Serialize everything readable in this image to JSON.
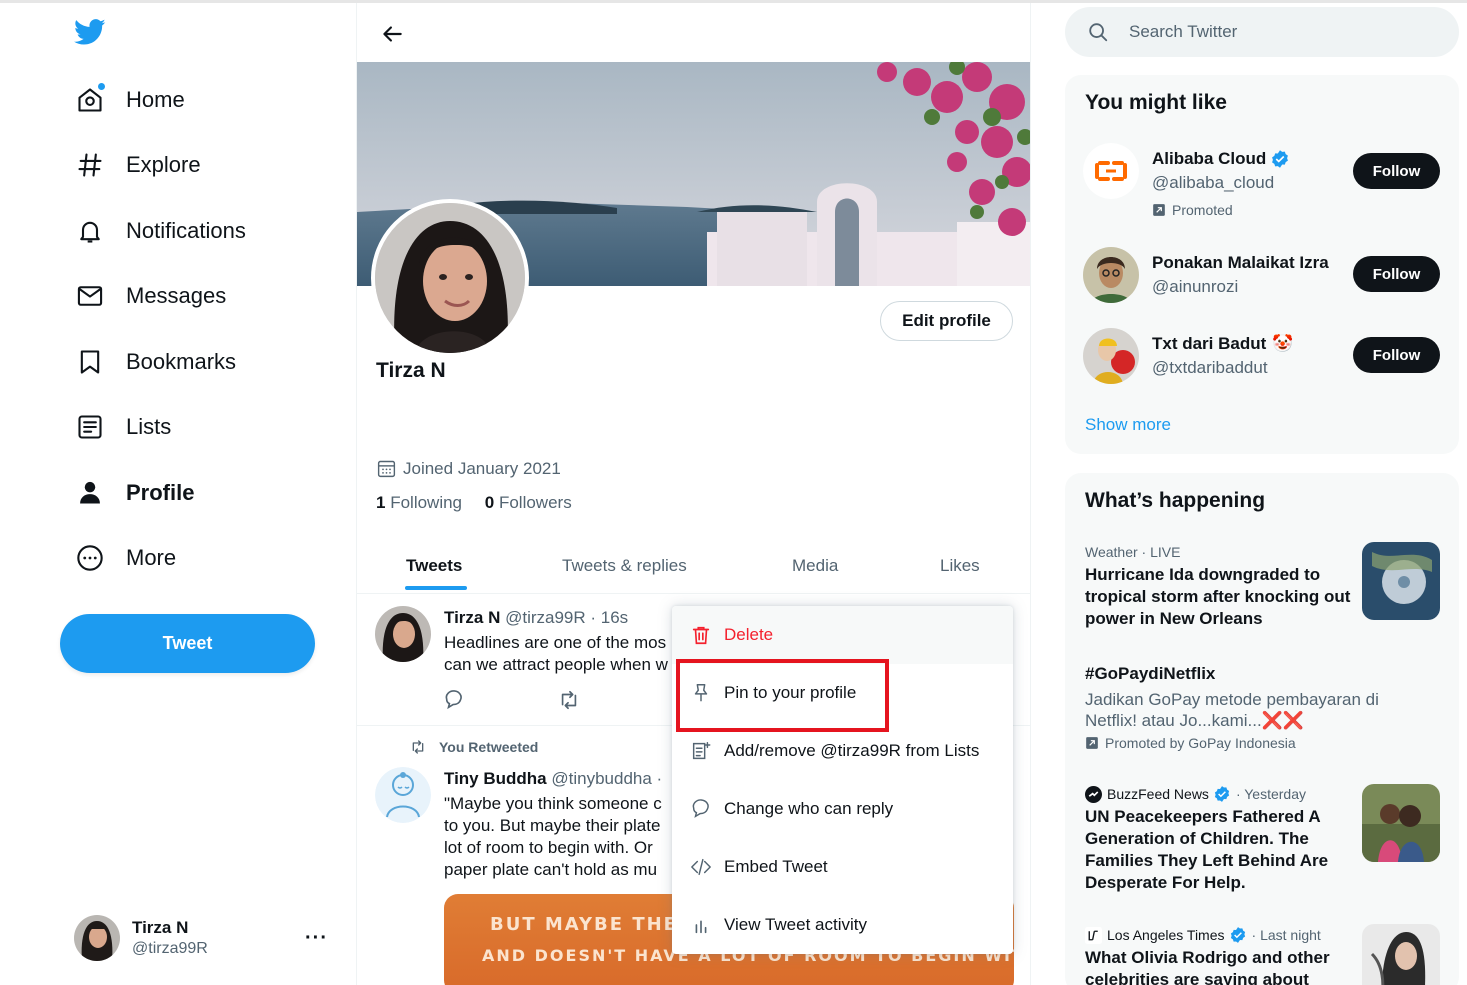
{
  "nav": {
    "items": [
      {
        "label": "Home",
        "icon": "home-icon"
      },
      {
        "label": "Explore",
        "icon": "hashtag-icon"
      },
      {
        "label": "Notifications",
        "icon": "bell-icon"
      },
      {
        "label": "Messages",
        "icon": "envelope-icon"
      },
      {
        "label": "Bookmarks",
        "icon": "bookmark-icon"
      },
      {
        "label": "Lists",
        "icon": "list-icon"
      },
      {
        "label": "Profile",
        "icon": "person-icon"
      },
      {
        "label": "More",
        "icon": "more-circle-icon"
      }
    ],
    "tweet_button": "Tweet",
    "account": {
      "name": "Tirza N",
      "handle": "@tirza99R",
      "more": "···"
    }
  },
  "profile": {
    "name": "Tirza N",
    "edit_button": "Edit profile",
    "joined": "Joined January 2021",
    "following_count": "1",
    "following_label": "Following",
    "followers_count": "0",
    "followers_label": "Followers",
    "tabs": [
      "Tweets",
      "Tweets & replies",
      "Media",
      "Likes"
    ]
  },
  "tweets": [
    {
      "name": "Tirza N",
      "meta": "@tirza99R · 16s",
      "lines": [
        "Headlines are one of the mos",
        "can we attract people when w"
      ]
    },
    {
      "retweeted_label": "You Retweeted",
      "name": "Tiny Buddha",
      "meta": "@tinybuddha ·",
      "lines": [
        "\"Maybe you think someone c",
        "to you. But maybe their plate",
        "lot of room to begin with. Or",
        "paper plate can't hold as mu"
      ],
      "image_lines": [
        "BUT MAYBE THEIR P",
        "AND DOESN'T HAVE A LOT OF ROOM TO BEGIN WITH."
      ]
    }
  ],
  "menu": {
    "items": [
      {
        "label": "Delete",
        "icon": "trash-icon"
      },
      {
        "label": "Pin to your profile",
        "icon": "pin-icon"
      },
      {
        "label": "Add/remove @tirza99R from Lists",
        "icon": "list-add-icon"
      },
      {
        "label": "Change who can reply",
        "icon": "reply-bubble-icon"
      },
      {
        "label": "Embed Tweet",
        "icon": "code-icon"
      },
      {
        "label": "View Tweet activity",
        "icon": "bar-chart-icon"
      }
    ]
  },
  "search": {
    "placeholder": "Search Twitter"
  },
  "who_to_follow": {
    "title": "You might like",
    "people": [
      {
        "name": "Alibaba Cloud",
        "handle": "@alibaba_cloud",
        "verified": true,
        "promoted": "Promoted",
        "button": "Follow"
      },
      {
        "name": "Ponakan Malaikat Izra",
        "handle": "@ainunrozi",
        "button": "Follow"
      },
      {
        "name": "Txt dari Badut",
        "emoji": "🤡",
        "handle": "@txtdaribaddut",
        "button": "Follow"
      }
    ],
    "show_more": "Show more"
  },
  "trends": {
    "title": "What’s happening",
    "items": [
      {
        "meta": "Weather · LIVE",
        "title": "Hurricane Ida downgraded to tropical storm after knocking out power in New Orleans"
      },
      {
        "title": "#GoPaydiNetflix",
        "desc": "Jadikan GoPay metode pembayaran di Netflix! atau Jo...kami...❌❌",
        "promo": "Promoted by GoPay Indonesia"
      },
      {
        "source": "BuzzFeed News",
        "time": "· Yesterday",
        "title": "UN Peacekeepers Fathered A Generation of Children. The Families They Left Behind Are Desperate For Help."
      },
      {
        "source": "Los Angeles Times",
        "time": "· Last night",
        "title": "What Olivia Rodrigo and other celebrities are saying about"
      }
    ]
  },
  "colors": {
    "accent": "#1d9bf0",
    "danger": "#f4212e",
    "text": "#0f1419",
    "muted": "#536471",
    "highlight_box": "#e5141f"
  }
}
